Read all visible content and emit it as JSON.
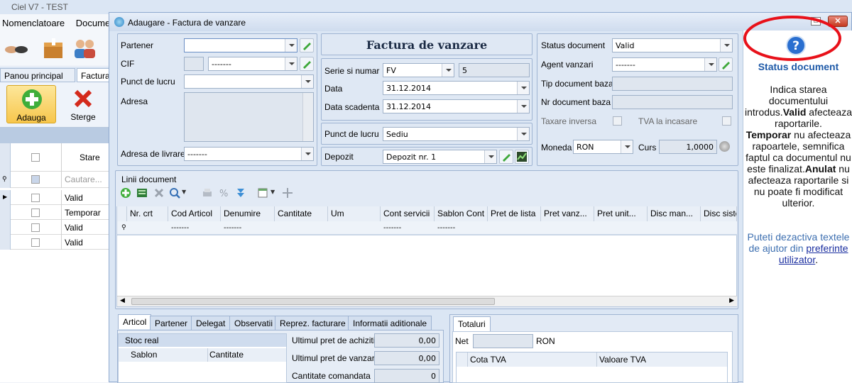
{
  "app": {
    "title": "Ciel V7 - TEST",
    "menu": [
      "Nomenclatoare",
      "Documen"
    ],
    "tabs": [
      "Panou principal",
      "Factura"
    ],
    "actions": {
      "add": "Adauga",
      "delete": "Sterge"
    },
    "grid": {
      "header": "Stare",
      "search_placeholder": "Cautare...",
      "rows": [
        "Valid",
        "Temporar",
        "Valid",
        "Valid"
      ]
    }
  },
  "dialog": {
    "title": "Adaugare - Factura de vanzare",
    "heading": "Factura de vanzare",
    "partner": {
      "partener_label": "Partener",
      "partener_value": "",
      "cif_label": "CIF",
      "cif_value": "-------",
      "punct_label": "Punct de lucru",
      "punct_value": "",
      "adresa_label": "Adresa",
      "livrare_label": "Adresa de livrare",
      "livrare_value": "-------"
    },
    "doc": {
      "serie_label": "Serie si numar",
      "serie_value": "FV",
      "numar_value": "5",
      "data_label": "Data",
      "data_value": "31.12.2014",
      "scadenta_label": "Data scadenta",
      "scadenta_value": "31.12.2014",
      "punct_label": "Punct de lucru",
      "punct_value": "Sediu",
      "depozit_label": "Depozit",
      "depozit_value": "Depozit nr. 1"
    },
    "status": {
      "status_label": "Status document",
      "status_value": "Valid",
      "agent_label": "Agent vanzari",
      "agent_value": "-------",
      "tipbaza_label": "Tip document baza",
      "nrbaza_label": "Nr document baza",
      "taxare_label": "Taxare inversa",
      "tva_label": "TVA la incasare",
      "moneda_label": "Moneda",
      "moneda_value": "RON",
      "curs_label": "Curs",
      "curs_value": "1,0000"
    },
    "lines": {
      "title": "Linii document",
      "columns": [
        "Nr. crt",
        "Cod Articol",
        "Denumire",
        "Cantitate",
        "Um",
        "Cont servicii",
        "Sablon Cont",
        "Pret de lista",
        "Pret vanz...",
        "Pret unit...",
        "Disc man...",
        "Disc siste..."
      ],
      "filter": [
        "-------",
        "-------",
        "-------",
        "-------"
      ]
    },
    "bottom_tabs": [
      "Articol",
      "Partener",
      "Delegat",
      "Observatii",
      "Reprez. facturare",
      "Informatii aditionale"
    ],
    "stock": {
      "title": "Stoc real",
      "col1": "Sablon",
      "col2": "Cantitate",
      "achizitie_label": "Ultimul pret de achizitie",
      "achizitie_value": "0,00",
      "vanzare_label": "Ultimul pret de vanzare",
      "vanzare_value": "0,00",
      "comandata_label": "Cantitate comandata",
      "comandata_value": "0"
    },
    "totals": {
      "tab": "Totaluri",
      "net_label": "Net",
      "currency": "RON",
      "col1": "Cota TVA",
      "col2": "Valoare TVA"
    }
  },
  "help": {
    "title": "Status document",
    "p1a": "Indica starea documentului introdus.",
    "w_valid": "Valid",
    "p1b": " afecteaza raportarile.",
    "w_temporar": "Temporar",
    "p1c": " nu afecteaza rapoartele, semnifica faptul ca documentul nu este finalizat.",
    "w_anulat": "Anulat",
    "p1d": " nu afecteaza raportarile si nu poate fi modificat ulterior.",
    "p2": "Puteti dezactiva textele de ajutor din",
    "link": "preferinte utilizator",
    "p2end": "."
  },
  "colors": {
    "accent": "#1f5aa8",
    "annotation": "#e8111a",
    "help_text": "#3d6fb0"
  }
}
